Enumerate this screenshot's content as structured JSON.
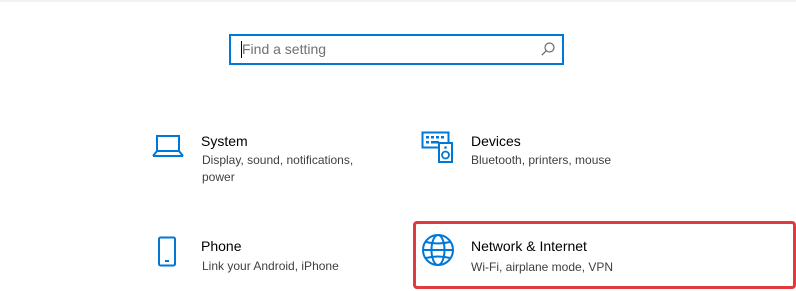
{
  "search": {
    "placeholder": "Find a setting",
    "value": ""
  },
  "categories": [
    {
      "title": "System",
      "description": "Display, sound, notifications, power",
      "icon": "laptop-icon"
    },
    {
      "title": "Devices",
      "description": "Bluetooth, printers, mouse",
      "icon": "keyboard-speaker-icon"
    },
    {
      "title": "Phone",
      "description": "Link your Android, iPhone",
      "icon": "phone-icon"
    },
    {
      "title": "Network & Internet",
      "description": "Wi-Fi, airplane mode, VPN",
      "icon": "globe-icon",
      "highlighted": true
    }
  ],
  "colors": {
    "accent": "#0078d7",
    "highlight_border": "#e03a3e"
  }
}
